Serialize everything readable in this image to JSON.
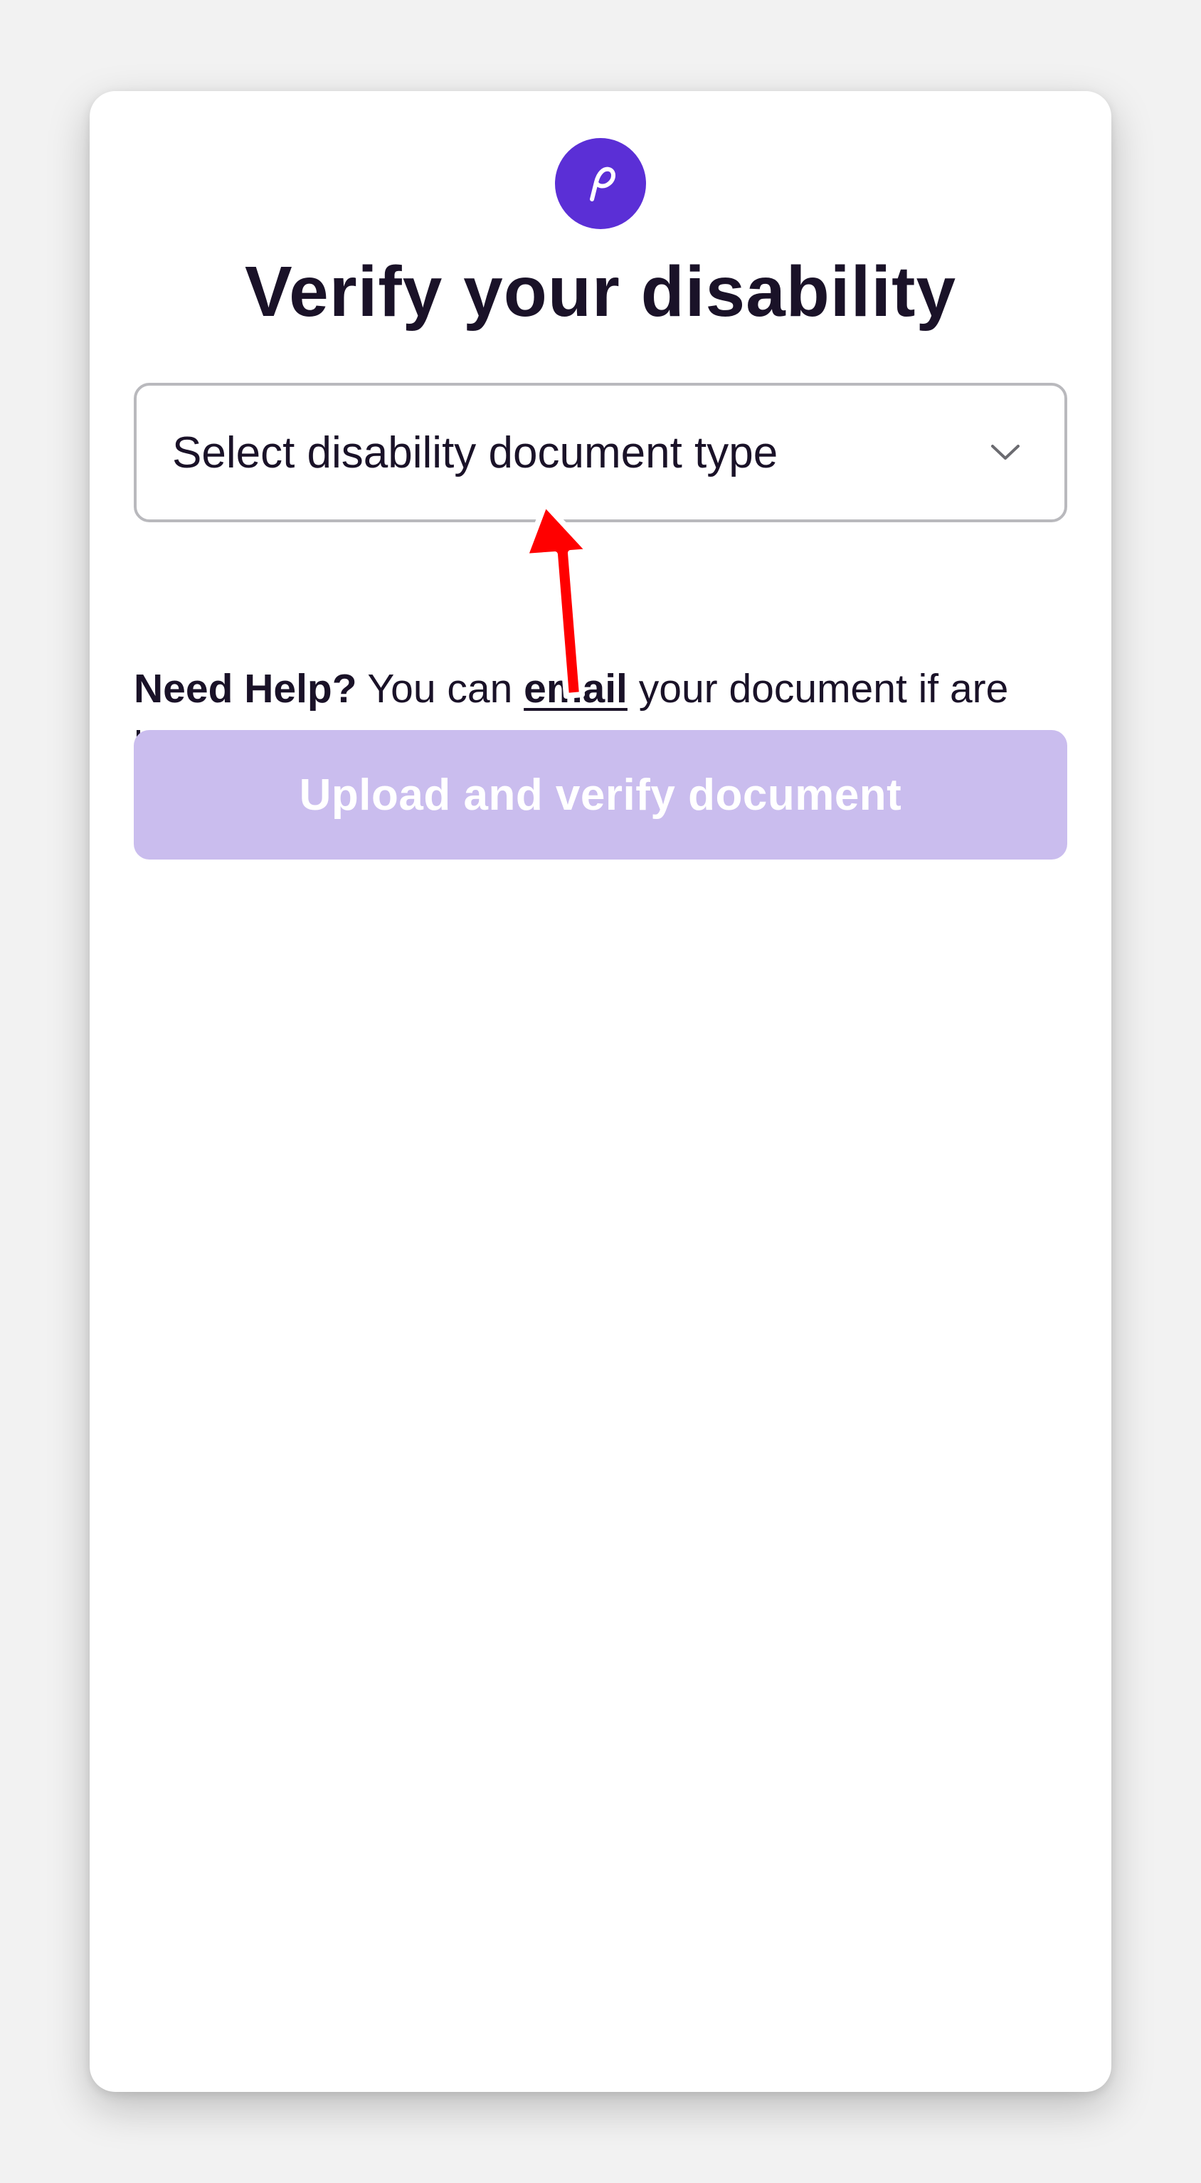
{
  "brand": {
    "logo_icon": "paypal-style-p-logo-icon",
    "accent": "#5b2fd6"
  },
  "page": {
    "title": "Verify your disability"
  },
  "select": {
    "placeholder": "Select disability document type",
    "icon": "chevron-down-icon"
  },
  "help": {
    "bold": "Need Help?",
    "before_link": " You can ",
    "link_text": "email",
    "after_link": " your document if are having problems uploading."
  },
  "upload_button": {
    "label": "Upload and verify document",
    "disabled_color": "#cabdee"
  },
  "annotation": {
    "icon": "red-arrow-icon",
    "color": "#ff0000"
  }
}
